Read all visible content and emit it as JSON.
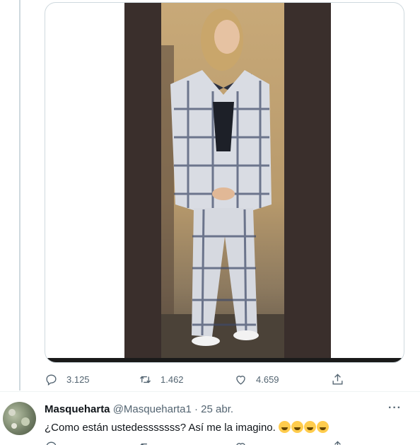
{
  "tweet_main": {
    "stats": {
      "replies": "3.125",
      "retweets": "1.462",
      "likes": "4.659"
    }
  },
  "reply": {
    "display_name": "Masqueharta",
    "handle_and_time": "@Masqueharta1 · 25 abr.",
    "text": "¿Como están ustedesssssss? Así me la imagino.",
    "emoji_count": 4,
    "more_label": "···"
  },
  "icons": [
    "reply-icon",
    "retweet-icon",
    "like-icon",
    "share-icon",
    "more-icon"
  ],
  "colors": {
    "text_primary": "#0f1419",
    "text_secondary": "#536471",
    "border": "#cfd9de"
  }
}
